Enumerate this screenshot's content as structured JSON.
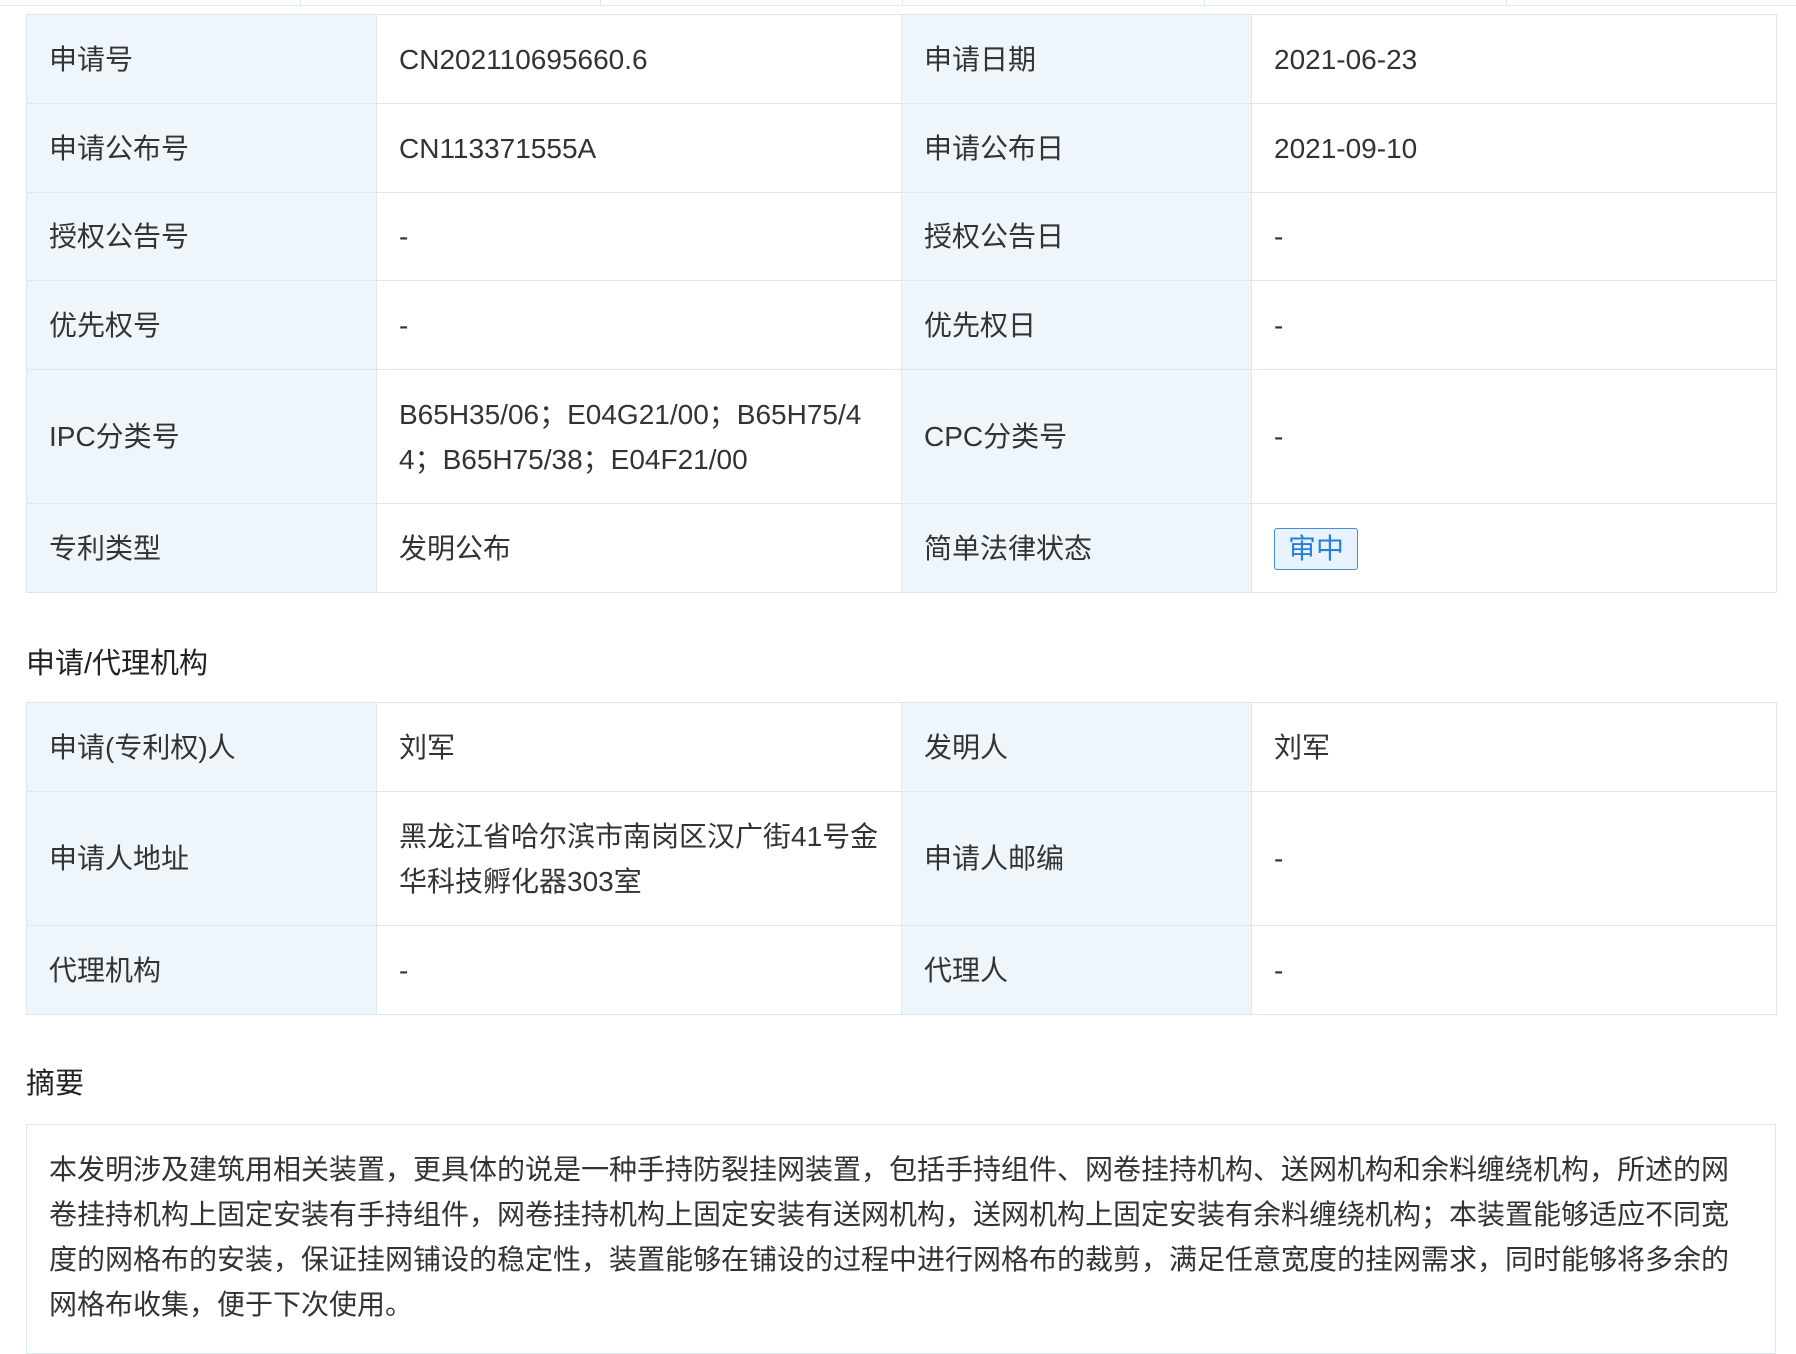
{
  "basic_info": {
    "rows": [
      {
        "l1": "申请号",
        "v1": "CN202110695660.6",
        "l2": "申请日期",
        "v2": "2021-06-23"
      },
      {
        "l1": "申请公布号",
        "v1": "CN113371555A",
        "l2": "申请公布日",
        "v2": "2021-09-10"
      },
      {
        "l1": "授权公告号",
        "v1": "-",
        "l2": "授权公告日",
        "v2": "-"
      },
      {
        "l1": "优先权号",
        "v1": "-",
        "l2": "优先权日",
        "v2": "-"
      },
      {
        "l1": "IPC分类号",
        "v1": "B65H35/06；E04G21/00；B65H75/44；B65H75/38；E04F21/00",
        "l2": "CPC分类号",
        "v2": "-"
      },
      {
        "l1": "专利类型",
        "v1": "发明公布",
        "l2": "简单法律状态",
        "v2": "审中"
      }
    ]
  },
  "agency_section": {
    "title": "申请/代理机构",
    "rows": [
      {
        "l1": "申请(专利权)人",
        "v1": "刘军",
        "l2": "发明人",
        "v2": "刘军"
      },
      {
        "l1": "申请人地址",
        "v1": "黑龙江省哈尔滨市南岗区汉广街41号金华科技孵化器303室",
        "l2": "申请人邮编",
        "v2": "-"
      },
      {
        "l1": "代理机构",
        "v1": "-",
        "l2": "代理人",
        "v2": "-"
      }
    ]
  },
  "abstract_section": {
    "title": "摘要",
    "text": "本发明涉及建筑用相关装置，更具体的说是一种手持防裂挂网装置，包括手持组件、网卷挂持机构、送网机构和余料缠绕机构，所述的网卷挂持机构上固定安装有手持组件，网卷挂持机构上固定安装有送网机构，送网机构上固定安装有余料缠绕机构；本装置能够适应不同宽度的网格布的安装，保证挂网铺设的稳定性，装置能够在铺设的过程中进行网格布的裁剪，满足任意宽度的挂网需求，同时能够将多余的网格布收集，便于下次使用。"
  },
  "colors": {
    "label_bg": "#eff6fb",
    "border": "#dde7f0",
    "badge_border": "#3f8ddb",
    "badge_text": "#2680d9"
  }
}
